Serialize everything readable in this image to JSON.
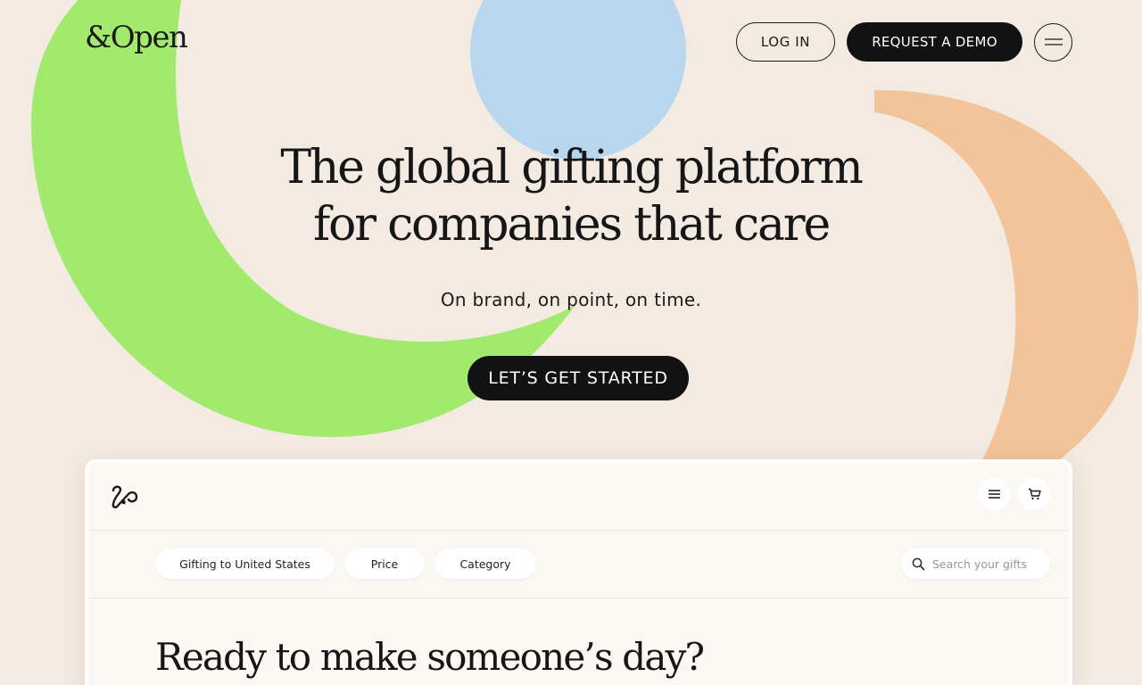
{
  "brand": {
    "logo_text": "&Open"
  },
  "nav": {
    "login_label": "LOG IN",
    "demo_label": "REQUEST A DEMO",
    "menu_icon": "hamburger-icon"
  },
  "hero": {
    "title_line1": "The global gifting platform",
    "title_line2": "for companies that care",
    "subtitle": "On brand, on point, on time.",
    "cta_label": "LET’S GET STARTED"
  },
  "preview": {
    "logo_icon": "andopen-mark-icon",
    "menu_icon": "hamburger-icon",
    "cart_icon": "cart-icon",
    "filters": [
      {
        "label": "Gifting to United States"
      },
      {
        "label": "Price"
      },
      {
        "label": "Category"
      }
    ],
    "search_placeholder": "Search your gifts",
    "heading": "Ready to make someone’s day?"
  },
  "colors": {
    "background": "#f3ebe1",
    "green_arc": "#a2ea6e",
    "blue_circle": "#b8d7ee",
    "peach_arc": "#f3c399",
    "dark_button": "#121212"
  }
}
